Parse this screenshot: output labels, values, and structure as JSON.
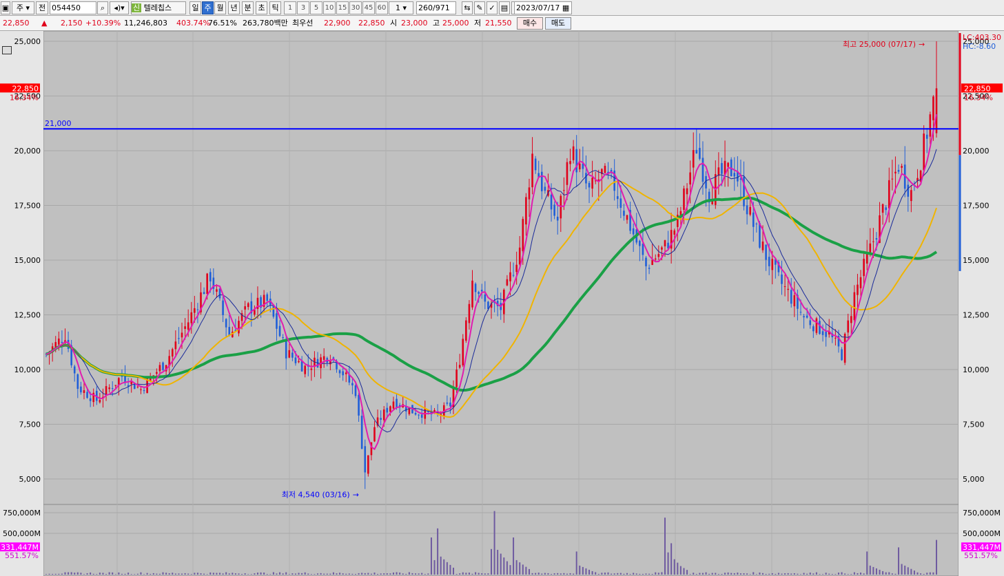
{
  "toolbar": {
    "market": "주",
    "prefix": "전",
    "code": "054450",
    "badge": "신",
    "stock_name": "텔레칩스",
    "periods": [
      "일",
      "주",
      "월",
      "년",
      "분",
      "초",
      "틱"
    ],
    "selected_period": "주",
    "intervals": [
      "1",
      "3",
      "5",
      "10",
      "15",
      "30",
      "45",
      "60"
    ],
    "multiplier": "1",
    "count": "260",
    "total": "/971",
    "date": "2023/07/17"
  },
  "quote": {
    "price": "22,850",
    "change_arrow": "▲",
    "change": "2,150",
    "change_pct": "+10.39%",
    "volume": "11,246,803",
    "volume_ratio": "403.74%",
    "turnover": "76.51%",
    "amount": "263,780백만",
    "best_label": "최우선",
    "bid": "22,900",
    "ask": "22,850",
    "open_label": "시",
    "open": "23,000",
    "high_label": "고",
    "high": "25,000",
    "low_label": "저",
    "low": "21,550",
    "buy_label": "매수",
    "sell_label": "매도"
  },
  "colors": {
    "up": "#e0001a",
    "down": "#1f5ed8",
    "ma_short": "#e01cb0",
    "ma_mid": "#1a2a9a",
    "ma_long": "#f0b400",
    "ma_longest": "#1aa046",
    "hline": "#0000ff",
    "volume": "#6e5aa0",
    "background": "#c0c0c0"
  },
  "chart_data": {
    "type": "candlestick",
    "ylim": [
      4000,
      26000
    ],
    "y_ticks": [
      "25,000",
      "22,500",
      "20,000",
      "17,500",
      "15,000",
      "12,500",
      "10,000",
      "7,500",
      "5,000"
    ],
    "y_tick_values": [
      25000,
      22500,
      20000,
      17500,
      15000,
      12500,
      10000,
      7500,
      5000
    ],
    "current_price_label": "22,850",
    "current_pct_label": "16.34%",
    "hline_value": 21000,
    "hline_label": "21,000",
    "max_annotation": "최고 25,000 (07/17)",
    "max_arrow": "→",
    "min_annotation": "최저 4,540 (03/16)",
    "min_arrow": "→",
    "lc_label": "LC:403.30",
    "hc_label": "HC:-8.60",
    "volume_ticks": [
      "750,000M",
      "500,000M"
    ],
    "volume_tick_values": [
      750000,
      500000
    ],
    "volume_current_label": "331,447M",
    "volume_pct_label": "551.57%",
    "volume_ylim": [
      0,
      800000
    ],
    "anchors": [
      [
        0,
        10700
      ],
      [
        6,
        11600
      ],
      [
        10,
        9200
      ],
      [
        16,
        8600
      ],
      [
        24,
        9700
      ],
      [
        30,
        9100
      ],
      [
        38,
        10400
      ],
      [
        45,
        12200
      ],
      [
        52,
        14300
      ],
      [
        58,
        11600
      ],
      [
        64,
        12800
      ],
      [
        70,
        13100
      ],
      [
        76,
        10800
      ],
      [
        82,
        10100
      ],
      [
        90,
        10700
      ],
      [
        98,
        9000
      ],
      [
        101,
        5300
      ],
      [
        104,
        7400
      ],
      [
        110,
        8600
      ],
      [
        116,
        8100
      ],
      [
        124,
        7900
      ],
      [
        128,
        8400
      ],
      [
        131,
        10500
      ],
      [
        135,
        14200
      ],
      [
        139,
        13000
      ],
      [
        144,
        12800
      ],
      [
        150,
        15600
      ],
      [
        154,
        19800
      ],
      [
        158,
        18000
      ],
      [
        162,
        16800
      ],
      [
        166,
        20100
      ],
      [
        172,
        18100
      ],
      [
        176,
        18900
      ],
      [
        180,
        18400
      ],
      [
        186,
        16200
      ],
      [
        190,
        14700
      ],
      [
        196,
        15600
      ],
      [
        200,
        16700
      ],
      [
        206,
        20200
      ],
      [
        210,
        18100
      ],
      [
        214,
        18900
      ],
      [
        218,
        19200
      ],
      [
        224,
        16600
      ],
      [
        228,
        15200
      ],
      [
        232,
        14100
      ],
      [
        236,
        13300
      ],
      [
        240,
        12400
      ],
      [
        244,
        12000
      ],
      [
        248,
        11600
      ],
      [
        252,
        10700
      ],
      [
        256,
        13400
      ],
      [
        262,
        15900
      ],
      [
        266,
        17700
      ],
      [
        270,
        19400
      ],
      [
        274,
        18100
      ],
      [
        278,
        20200
      ],
      [
        282,
        22850
      ]
    ],
    "volume_bursts": [
      [
        122,
        450000
      ],
      [
        124,
        560000
      ],
      [
        141,
        310000
      ],
      [
        142,
        770000
      ],
      [
        148,
        450000
      ],
      [
        168,
        280000
      ],
      [
        196,
        690000
      ],
      [
        198,
        380000
      ],
      [
        260,
        280000
      ],
      [
        270,
        330000
      ],
      [
        282,
        420000
      ]
    ]
  }
}
